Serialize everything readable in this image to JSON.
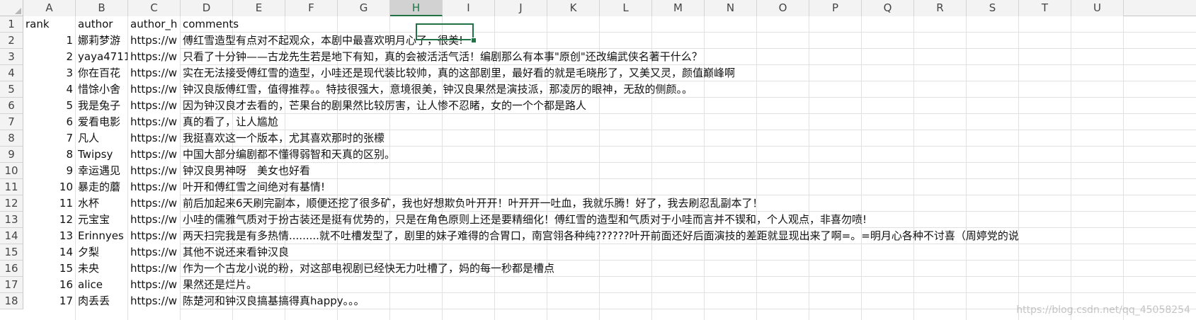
{
  "columns": [
    "A",
    "B",
    "C",
    "D",
    "E",
    "F",
    "G",
    "H",
    "I",
    "J",
    "K",
    "L",
    "M",
    "N",
    "O",
    "P",
    "Q",
    "R",
    "S",
    "T",
    "U"
  ],
  "selected_column": "H",
  "rows": [
    {
      "num": "1",
      "a": "rank",
      "b": "author",
      "c": "author_h",
      "d": "comments"
    },
    {
      "num": "2",
      "a": "1",
      "b": "娜莉梦游",
      "c": "https://w",
      "d": "傅红雪造型有点对不起观众，本剧中最喜欢明月心了，很美!"
    },
    {
      "num": "3",
      "a": "2",
      "b": "yaya4711",
      "c": "https://w",
      "d": "只看了十分钟——古龙先生若是地下有知，真的会被活活气活！编剧那么有本事\"原创\"还改编武侠名著干什么？"
    },
    {
      "num": "4",
      "a": "3",
      "b": "你在百花",
      "c": "https://w",
      "d": "实在无法接受傅红雪的造型，小哇还是现代装比较帅，真的这部剧里，最好看的就是毛晓彤了，又美又灵，颜值巅峰啊"
    },
    {
      "num": "5",
      "a": "4",
      "b": "惜馀小舍",
      "c": "https://w",
      "d": "钟汉良版傅红雪，值得推荐。。特技很强大，意境很美，钟汉良果然是演技派，那凌厉的眼神，无敌的侧颜。。"
    },
    {
      "num": "6",
      "a": "5",
      "b": "我是兔子",
      "c": "https://w",
      "d": "因为钟汉良才去看的，芒果台的剧果然比较厉害，让人惨不忍睹，女的一个个都是路人"
    },
    {
      "num": "7",
      "a": "6",
      "b": "爱看电影",
      "c": "https://w",
      "d": "真的看了，让人尴尬"
    },
    {
      "num": "8",
      "a": "7",
      "b": "凡人",
      "c": "https://w",
      "d": "我挺喜欢这一个版本，尤其喜欢那时的张檬"
    },
    {
      "num": "9",
      "a": "8",
      "b": "Twipsy",
      "c": "https://w",
      "d": "中国大部分编剧都不懂得弱智和天真的区别。"
    },
    {
      "num": "10",
      "a": "9",
      "b": "幸运遇见",
      "c": "https://w",
      "d": "钟汉良男神呀　美女也好看"
    },
    {
      "num": "11",
      "a": "10",
      "b": "暴走的蘑",
      "c": "https://w",
      "d": "叶开和傅红雪之间绝对有基情!"
    },
    {
      "num": "12",
      "a": "11",
      "b": "水杯",
      "c": "https://w",
      "d": "前后加起来6天刷完副本，顺便还挖了很多矿，我也好想欺负叶开开！叶开开一吐血，我就乐腾！好了，我去刷忍乱副本了！"
    },
    {
      "num": "13",
      "a": "12",
      "b": "元宝宝",
      "c": "https://w",
      "d": "小哇的儒雅气质对于扮古装还是挺有优势的，只是在角色原则上还是要精细化！傅红雪的造型和气质对于小哇而言并不锲和，个人观点，非喜勿喷!"
    },
    {
      "num": "14",
      "a": "13",
      "b": "Erinnyes",
      "c": "https://w",
      "d": "两天扫完我是有多热情.........就不吐槽发型了，剧里的妹子难得的合胃口，南宫翎各种纯??????叶开前面还好后面演技的差距就显现出来了啊=。=明月心各种不讨喜（周婷党的说"
    },
    {
      "num": "15",
      "a": "14",
      "b": "夕梨",
      "c": "https://w",
      "d": "其他不说还来看钟汉良"
    },
    {
      "num": "16",
      "a": "15",
      "b": "未央",
      "c": "https://w",
      "d": "作为一个古龙小说的粉，对这部电视剧已经快无力吐槽了，妈的每一秒都是槽点"
    },
    {
      "num": "17",
      "a": "16",
      "b": "alice",
      "c": "https://w",
      "d": "果然还是烂片。"
    },
    {
      "num": "18",
      "a": "17",
      "b": "肉丢丢",
      "c": "https://w",
      "d": "陈楚河和钟汉良搞基搞得真happy。。。"
    }
  ],
  "watermark": "https://blog.csdn.net/qq_45058254"
}
